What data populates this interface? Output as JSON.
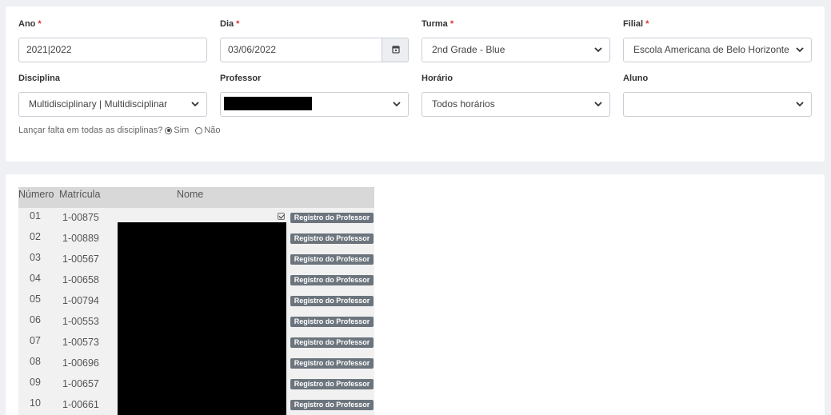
{
  "filters": {
    "ano": {
      "label": "Ano",
      "required": "*",
      "value": "2021|2022"
    },
    "dia": {
      "label": "Dia",
      "required": "*",
      "value": "03/06/2022",
      "icon": "calendar-icon"
    },
    "turma": {
      "label": "Turma",
      "required": "*",
      "value": "2nd Grade - Blue"
    },
    "filial": {
      "label": "Filial",
      "required": "*",
      "value": "Escola Americana de Belo Horizonte"
    },
    "disciplina": {
      "label": "Disciplina",
      "value": "Multidisciplinary | Multidisciplinar"
    },
    "professor": {
      "label": "Professor",
      "value": ""
    },
    "horario": {
      "label": "Horário",
      "value": "Todos horários"
    },
    "aluno": {
      "label": "Aluno",
      "value": ""
    }
  },
  "absence": {
    "question": "Lançar falta em todas as disciplinas?",
    "yes_label": "Sim",
    "no_label": "Não",
    "selected": "Sim"
  },
  "table": {
    "headers": {
      "numero": "Número",
      "matricula": "Matrícula",
      "nome": "Nome"
    },
    "badge_label": "Registro do Professor",
    "rows": [
      {
        "numero": "01",
        "matricula": "1-00875",
        "checked": true
      },
      {
        "numero": "02",
        "matricula": "1-00889",
        "checked": false
      },
      {
        "numero": "03",
        "matricula": "1-00567",
        "checked": false
      },
      {
        "numero": "04",
        "matricula": "1-00658",
        "checked": false
      },
      {
        "numero": "05",
        "matricula": "1-00794",
        "checked": false
      },
      {
        "numero": "06",
        "matricula": "1-00553",
        "checked": false
      },
      {
        "numero": "07",
        "matricula": "1-00573",
        "checked": false
      },
      {
        "numero": "08",
        "matricula": "1-00696",
        "checked": true
      },
      {
        "numero": "09",
        "matricula": "1-00657",
        "checked": false
      },
      {
        "numero": "10",
        "matricula": "1-00661",
        "checked": false
      }
    ]
  },
  "colors": {
    "required": "#d9342b",
    "badge": "#6c757d",
    "header": "#d8d8d8",
    "row": "#f1f1f1"
  }
}
